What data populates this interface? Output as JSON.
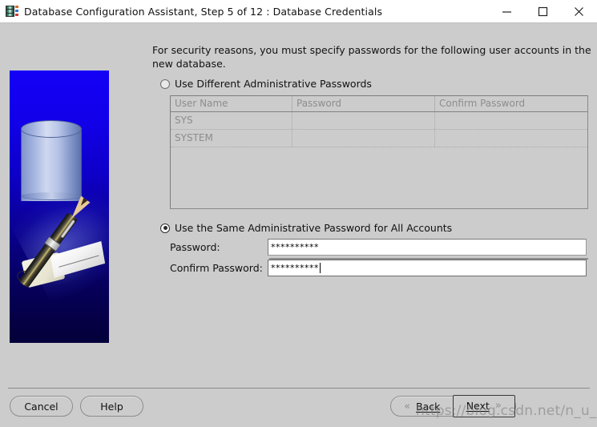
{
  "window": {
    "title": "Database Configuration Assistant, Step 5 of 12 : Database Credentials",
    "icon": "database-app-icon",
    "controls": {
      "minimize": "minimize-icon",
      "maximize": "maximize-icon",
      "close": "close-icon"
    }
  },
  "banner": {
    "alt": "database-cylinder-with-pen-signing-tag",
    "gradient_top": "#1400f5",
    "gradient_bottom": "#04003a"
  },
  "main": {
    "intro": "For security reasons, you must specify passwords for the following user accounts in the new database.",
    "options": {
      "different": {
        "label": "Use Different Administrative Passwords",
        "selected": false
      },
      "same": {
        "label": "Use the Same Administrative Password for All Accounts",
        "selected": true
      }
    },
    "table": {
      "enabled": false,
      "headers": [
        "User Name",
        "Password",
        "Confirm Password"
      ],
      "rows": [
        {
          "user_name": "SYS",
          "password": "",
          "confirm_password": ""
        },
        {
          "user_name": "SYSTEM",
          "password": "",
          "confirm_password": ""
        }
      ]
    },
    "fields": {
      "password": {
        "label": "Password:",
        "value": "**********",
        "focused": false
      },
      "confirm_password": {
        "label": "Confirm Password:",
        "value": "**********",
        "focused": true
      }
    }
  },
  "footer": {
    "cancel": "Cancel",
    "help": "Help",
    "back": "Back",
    "next": "Next",
    "back_chevron": "«",
    "next_chevron": "»"
  },
  "watermark": "https://blog.csdn.net/n_u_l_l_"
}
